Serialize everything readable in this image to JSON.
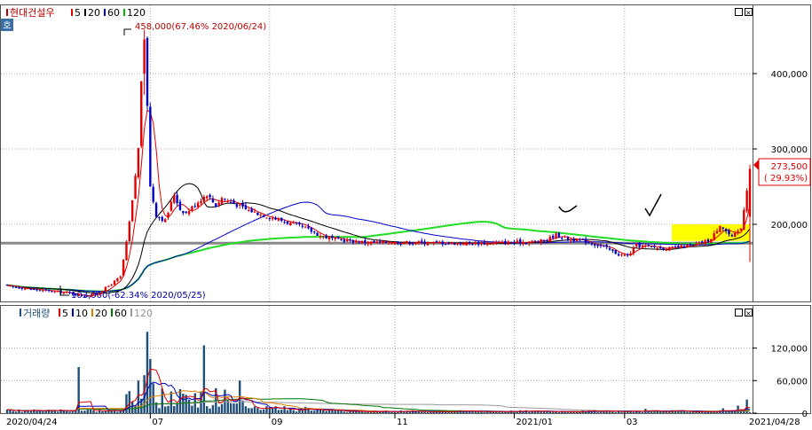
{
  "price_panel": {
    "legend": [
      {
        "label": "현대건설우",
        "color": "#c00000"
      },
      {
        "label": "5",
        "color": "#e00000"
      },
      {
        "label": "20",
        "color": "#000000"
      },
      {
        "label": "60",
        "color": "#0000cc"
      },
      {
        "label": "120",
        "color": "#00bb00"
      }
    ],
    "high_annotation": "458,000(67.46% 2020/06/24)",
    "low_annotation": "103,000(-62.34% 2020/05/25)",
    "last_price": "273,500",
    "last_change": "( 29.93%)"
  },
  "volume_panel": {
    "legend": [
      {
        "label": "거래량",
        "color": "#1e4e79"
      },
      {
        "label": "5",
        "color": "#e00000"
      },
      {
        "label": "10",
        "color": "#0000cc"
      },
      {
        "label": "20",
        "color": "#e08000"
      },
      {
        "label": "60",
        "color": "#007700"
      },
      {
        "label": "120",
        "color": "#999999"
      }
    ]
  },
  "x_axis": {
    "start_date": "2020/04/24",
    "end_date": "2021/04/28",
    "ticks": [
      "07",
      "09",
      "11",
      "2021/01",
      "03"
    ]
  },
  "chart_data": [
    {
      "type": "candlestick",
      "ylim": [
        100000,
        480000
      ],
      "yticks": [
        {
          "value": 400000,
          "label": "400,000"
        },
        {
          "value": 300000,
          "label": "300,000"
        },
        {
          "value": 200000,
          "label": "200,000"
        }
      ],
      "grid": true,
      "closes_by_month": [
        {
          "x": "2020/04",
          "close": 118000
        },
        {
          "x": "2020/05",
          "close": 108000
        },
        {
          "x": "2020/06",
          "close": 240000
        },
        {
          "x": "2020/07",
          "close": 215000
        },
        {
          "x": "2020/08",
          "close": 232000
        },
        {
          "x": "2020/09",
          "close": 210000
        },
        {
          "x": "2020/10",
          "close": 178000
        },
        {
          "x": "2020/11",
          "close": 175000
        },
        {
          "x": "2020/12",
          "close": 176000
        },
        {
          "x": "2021/01",
          "close": 180000
        },
        {
          "x": "2021/02",
          "close": 175000
        },
        {
          "x": "2021/03",
          "close": 168000
        },
        {
          "x": "2021/04",
          "close": 273500
        }
      ],
      "high": 458000,
      "low": 103000,
      "last": 273500
    },
    {
      "type": "bar",
      "yticks": [
        {
          "value": 120000,
          "label": "120,000"
        },
        {
          "value": 60000,
          "label": "60,000"
        },
        {
          "value": 0,
          "label": "0"
        }
      ],
      "ylim": [
        0,
        170000
      ],
      "grid": true
    }
  ]
}
